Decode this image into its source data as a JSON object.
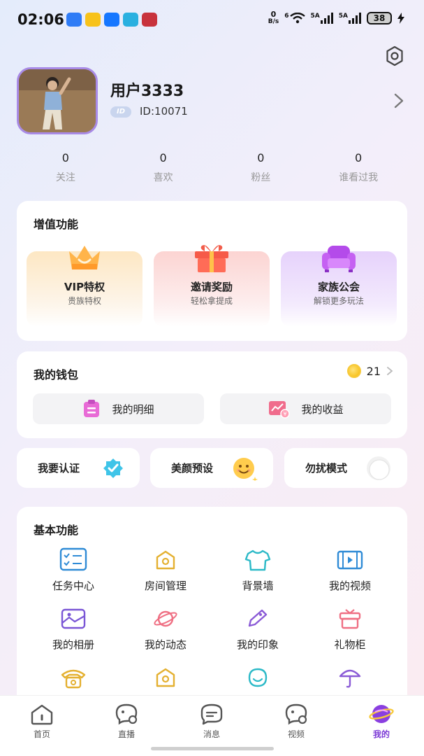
{
  "status_bar": {
    "time": "02:06",
    "net_speed": "0",
    "net_unit": "B/s",
    "wifi_label": "6",
    "sim1": "5A",
    "sim2": "5A",
    "battery": "38"
  },
  "profile": {
    "name": "用户3333",
    "id_badge": "ID",
    "id_text": "ID:10071"
  },
  "stats": [
    {
      "value": "0",
      "label": "关注"
    },
    {
      "value": "0",
      "label": "喜欢"
    },
    {
      "value": "0",
      "label": "粉丝"
    },
    {
      "value": "0",
      "label": "谁看过我"
    }
  ],
  "value_added": {
    "title": "增值功能",
    "items": [
      {
        "title": "VIP特权",
        "subtitle": "贵族特权",
        "icon": "crown-icon"
      },
      {
        "title": "邀请奖励",
        "subtitle": "轻松拿提成",
        "icon": "gift-icon"
      },
      {
        "title": "家族公会",
        "subtitle": "解锁更多玩法",
        "icon": "sofa-icon"
      }
    ]
  },
  "wallet": {
    "title": "我的钱包",
    "coins": "21",
    "buttons": [
      {
        "label": "我的明细",
        "icon": "clipboard-list-icon"
      },
      {
        "label": "我的收益",
        "icon": "earnings-chart-icon"
      }
    ]
  },
  "quick": [
    {
      "label": "我要认证",
      "icon": "verified-badge-icon"
    },
    {
      "label": "美颜预设",
      "icon": "smiley-face-icon"
    },
    {
      "label": "勿扰模式",
      "icon": "toggle-icon",
      "enabled": false
    }
  ],
  "basic": {
    "title": "基本功能",
    "items": [
      {
        "label": "任务中心",
        "icon": "task-list-icon"
      },
      {
        "label": "房间管理",
        "icon": "room-icon"
      },
      {
        "label": "背景墙",
        "icon": "tshirt-icon"
      },
      {
        "label": "我的视频",
        "icon": "film-icon"
      },
      {
        "label": "我的相册",
        "icon": "photo-album-icon"
      },
      {
        "label": "我的动态",
        "icon": "planet-icon"
      },
      {
        "label": "我的印象",
        "icon": "tag-pen-icon"
      },
      {
        "label": "礼物柜",
        "icon": "gift-cabinet-icon"
      },
      {
        "label": "",
        "icon": "telephone-icon"
      },
      {
        "label": "",
        "icon": "room-icon"
      },
      {
        "label": "",
        "icon": "drop-icon"
      },
      {
        "label": "",
        "icon": "umbrella-icon"
      }
    ]
  },
  "tabs": [
    {
      "label": "首页",
      "icon": "home-icon",
      "active": false
    },
    {
      "label": "直播",
      "icon": "live-icon",
      "active": false
    },
    {
      "label": "消息",
      "icon": "message-icon",
      "active": false
    },
    {
      "label": "视频",
      "icon": "video-icon",
      "active": false
    },
    {
      "label": "我的",
      "icon": "profile-planet-icon",
      "active": true
    }
  ],
  "colors": {
    "accent": "#7c3ad6",
    "cyan": "#2bb9c7",
    "gold": "#f5b800",
    "red": "#f04848"
  }
}
